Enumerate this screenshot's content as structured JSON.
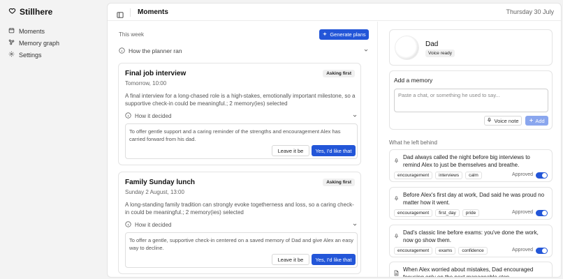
{
  "brand": {
    "name": "Stillhere",
    "icon": "heart-icon"
  },
  "sidebar": {
    "items": [
      {
        "label": "Moments",
        "icon": "calendar-icon"
      },
      {
        "label": "Memory graph",
        "icon": "graph-icon"
      },
      {
        "label": "Settings",
        "icon": "gear-icon"
      }
    ]
  },
  "header": {
    "title": "Moments",
    "date": "Thursday 30 July"
  },
  "plans": {
    "section_label": "This week",
    "generate_label": "Generate plans",
    "planner_label": "How the planner ran",
    "cards": [
      {
        "title": "Final job interview",
        "when": "Tomorrow, 10:00",
        "badge": "Asking first",
        "description": "A final interview for a long-chased role is a high-stakes, emotionally important milestone, so a supportive check-in could be meaningful.; 2 memory(ies) selected",
        "decided_label": "How it decided",
        "message": "To offer gentle support and a caring reminder of the strengths and encouragement Alex has carried forward from his dad.",
        "leave_label": "Leave it be",
        "accept_label": "Yes, I'd like that"
      },
      {
        "title": "Family Sunday lunch",
        "when": "Sunday 2 August, 13:00",
        "badge": "Asking first",
        "description": "A long-standing family tradition can strongly evoke togetherness and loss, so a caring check-in could be meaningful.; 2 memory(ies) selected",
        "decided_label": "How it decided",
        "message": "To offer a gentle, supportive check-in centered on a saved memory of Dad and give Alex an easy way to decline.",
        "leave_label": "Leave it be",
        "accept_label": "Yes, I'd like that"
      }
    ]
  },
  "profile": {
    "name": "Dad",
    "status": "Voice ready"
  },
  "add_memory": {
    "heading": "Add a memory",
    "placeholder": "Paste a chat, or something he used to say...",
    "voice_label": "Voice note",
    "add_label": "Add"
  },
  "memories": {
    "section_label": "What he left behind",
    "items": [
      {
        "text": "Dad always called the night before big interviews to remind Alex to just be themselves and breathe.",
        "icon": "microphone-icon",
        "tags": [
          "encouragement",
          "interviews",
          "calm"
        ],
        "status": "Approved",
        "approved": true
      },
      {
        "text": "Before Alex's first day at work, Dad said he was proud no matter how it went.",
        "icon": "microphone-icon",
        "tags": [
          "encouragement",
          "first_day",
          "pride"
        ],
        "status": "Approved",
        "approved": true
      },
      {
        "text": "Dad's classic line before exams: you've done the work, now go show them.",
        "icon": "microphone-icon",
        "tags": [
          "encouragement",
          "exams",
          "confidence"
        ],
        "status": "Approved",
        "approved": true
      },
      {
        "text": "When Alex worried about mistakes, Dad encouraged focusing only on the next manageable step.",
        "icon": "document-icon",
        "tags": [],
        "status": "",
        "approved": true
      }
    ]
  },
  "colors": {
    "accent": "#2356d8",
    "accent_disabled": "#8aa6ee",
    "background": "#f3f3f3"
  }
}
